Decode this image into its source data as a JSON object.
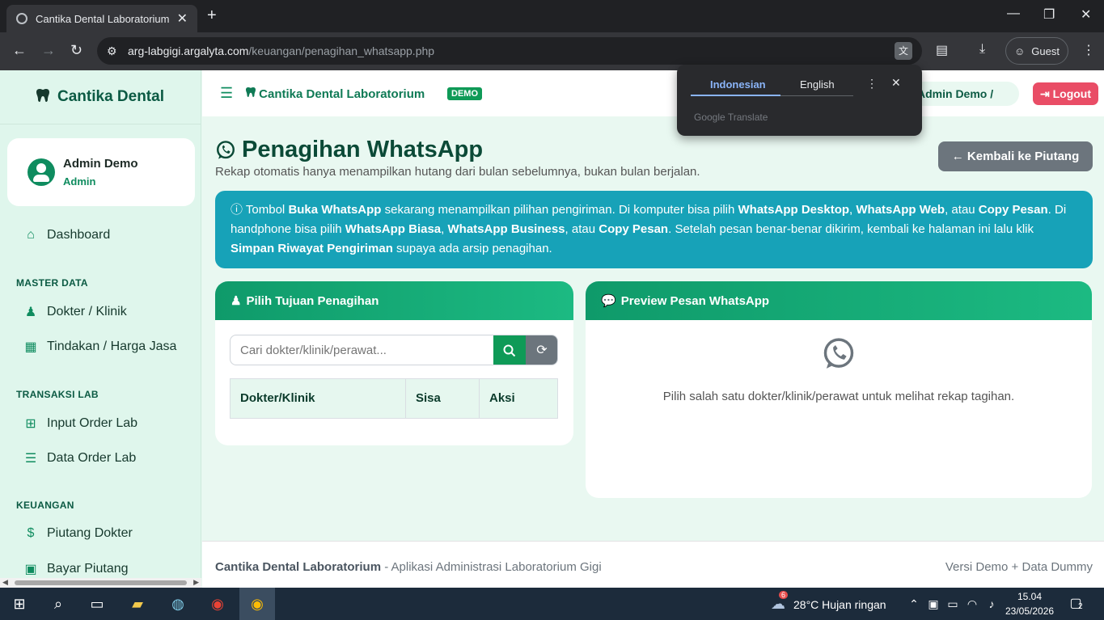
{
  "browser": {
    "tab_title": "Cantika Dental Laboratorium",
    "url_host": "arg-labgigi.argalyta.com",
    "url_path": "/keuangan/penagihan_whatsapp.php",
    "profile_label": "Guest"
  },
  "translate_popup": {
    "lang_active": "Indonesian",
    "lang_other": "English",
    "powered_by": "Google Translate"
  },
  "sidebar": {
    "brand": "Cantika Dental",
    "user_name": "Admin Demo",
    "user_role": "Admin",
    "dashboard": "Dashboard",
    "section_master": "MASTER DATA",
    "dokter_klinik": "Dokter / Klinik",
    "tindakan": "Tindakan / Harga Jasa",
    "section_transaksi": "TRANSAKSI LAB",
    "input_order": "Input Order Lab",
    "data_order": "Data Order Lab",
    "section_keuangan": "KEUANGAN",
    "piutang": "Piutang Dokter",
    "bayar": "Bayar Piutang"
  },
  "topnav": {
    "brand": "Cantika Dental Laboratorium",
    "badge": "DEMO",
    "user": "Admin Demo / Admin",
    "logout": "Logout"
  },
  "main": {
    "title": "Penagihan WhatsApp",
    "subtitle": "Rekap otomatis hanya menampilkan hutang dari bulan sebelumnya, bukan bulan berjalan.",
    "back_button": "Kembali ke Piutang",
    "info": {
      "t1": " Tombol ",
      "b1": "Buka WhatsApp",
      "t2": " sekarang menampilkan pilihan pengiriman. Di komputer bisa pilih ",
      "b2": "WhatsApp Desktop",
      "t3": ", ",
      "b3": "WhatsApp Web",
      "t4": ", atau ",
      "b4": "Copy Pesan",
      "t5": ". Di handphone bisa pilih ",
      "b5": "WhatsApp Biasa",
      "t6": ", ",
      "b6": "WhatsApp Business",
      "t7": ", atau ",
      "b7": "Copy Pesan",
      "t8": ". Setelah pesan benar-benar dikirim, kembali ke halaman ini lalu klik ",
      "b8": "Simpan Riwayat Pengiriman",
      "t9": " supaya ada arsip penagihan."
    },
    "target_card": {
      "title": "Pilih Tujuan Penagihan",
      "search_placeholder": "Cari dokter/klinik/perawat...",
      "columns": [
        "Dokter/Klinik",
        "Sisa",
        "Aksi"
      ]
    },
    "preview_card": {
      "title": "Preview Pesan WhatsApp",
      "empty_text": "Pilih salah satu dokter/klinik/perawat untuk melihat rekap tagihan."
    }
  },
  "footer": {
    "brand": "Cantika Dental Laboratorium",
    "desc": " - Aplikasi Administrasi Laboratorium Gigi",
    "right": "Versi Demo + Data Dummy"
  },
  "taskbar": {
    "weather": "28°C  Hujan ringan",
    "weather_badge": "6",
    "time": "15.04",
    "date": "23/05/2026",
    "notif_count": "2"
  }
}
